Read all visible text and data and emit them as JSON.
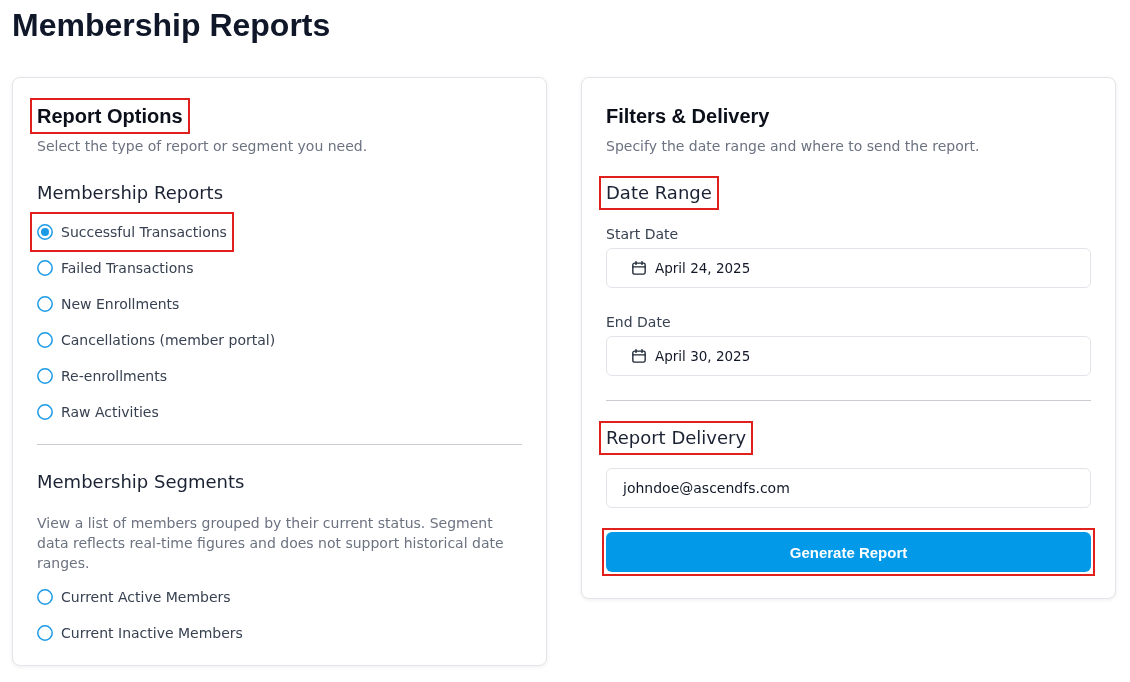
{
  "page": {
    "title": "Membership Reports"
  },
  "report_options": {
    "title": {
      "text": "Report Options",
      "highlighted": true
    },
    "subtitle": "Select the type of report or segment you need.",
    "sections": [
      {
        "heading": {
          "text": "Membership Reports",
          "highlighted": false
        },
        "options": [
          {
            "label": "Successful Transactions",
            "selected": true,
            "highlighted": true
          },
          {
            "label": "Failed Transactions",
            "selected": false,
            "highlighted": false
          },
          {
            "label": "New Enrollments",
            "selected": false,
            "highlighted": false
          },
          {
            "label": "Cancellations (member portal)",
            "selected": false,
            "highlighted": false
          },
          {
            "label": "Re-enrollments",
            "selected": false,
            "highlighted": false
          },
          {
            "label": "Raw Activities",
            "selected": false,
            "highlighted": false
          }
        ]
      },
      {
        "heading": {
          "text": "Membership Segments",
          "highlighted": false
        },
        "description": "View a list of members grouped by their current status. Segment data reflects real-time figures and does not support historical date ranges.",
        "options": [
          {
            "label": "Current Active Members",
            "selected": false,
            "highlighted": false
          },
          {
            "label": "Current Inactive Members",
            "selected": false,
            "highlighted": false
          }
        ]
      }
    ]
  },
  "filters_delivery": {
    "title": {
      "text": "Filters & Delivery",
      "highlighted": false
    },
    "subtitle": "Specify the date range and where to send the report.",
    "sections": [
      {
        "heading": {
          "text": "Date Range",
          "highlighted": true
        },
        "fields": [
          {
            "kind": "date",
            "label": "Start Date",
            "value": "April 24, 2025"
          },
          {
            "kind": "date",
            "label": "End Date",
            "value": "April 30, 2025"
          }
        ]
      },
      {
        "heading": {
          "text": "Report Delivery",
          "highlighted": true
        },
        "fields": [
          {
            "kind": "email",
            "value": "johndoe@ascendfs.com"
          }
        ]
      }
    ],
    "button": {
      "label": "Generate Report",
      "highlighted": true
    }
  }
}
